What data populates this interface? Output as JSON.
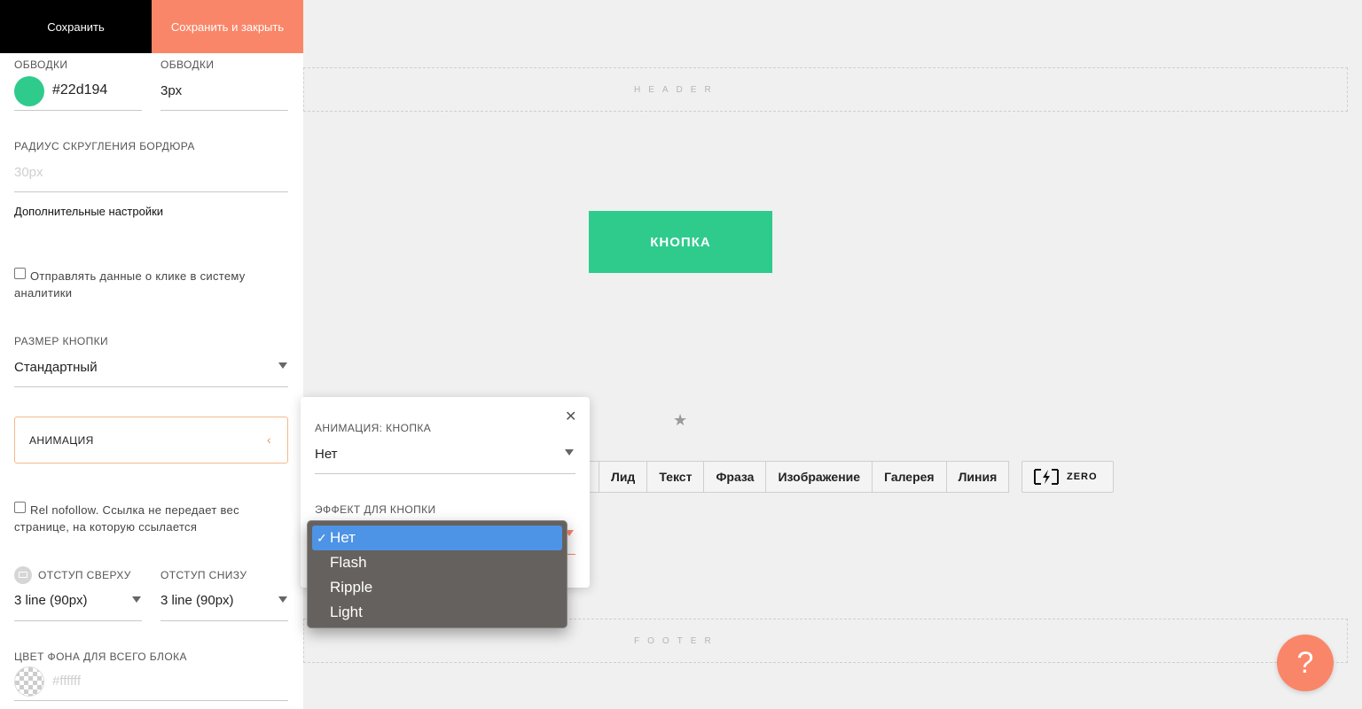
{
  "toolbar": {
    "save_label": "Сохранить",
    "save_close_label": "Сохранить и закрыть"
  },
  "settings": {
    "stroke_color": {
      "label": "ОБВОДКИ",
      "value": "#22d194"
    },
    "stroke_width": {
      "label": "ОБВОДКИ",
      "value": "3px"
    },
    "border_radius": {
      "label": "РАДИУС СКРУГЛЕНИЯ БОРДЮРА",
      "placeholder": "30px"
    },
    "advanced_title": "Дополнительные настройки",
    "analytics_checkbox": {
      "label": "Отправлять данные о клике в систему аналитики",
      "checked": false
    },
    "button_size": {
      "label": "РАЗМЕР КНОПКИ",
      "value": "Стандартный"
    },
    "animation_label": "АНИМАЦИЯ",
    "nofollow_checkbox": {
      "label": "Rel nofollow. Ссылка не передает вес странице, на которую ссылается",
      "checked": false
    },
    "padding_top": {
      "label": "ОТСТУП СВЕРХУ",
      "value": "3 line (90px)"
    },
    "padding_bottom": {
      "label": "ОТСТУП СНИЗУ",
      "value": "3 line (90px)"
    },
    "bg_color": {
      "label": "ЦВЕТ ФОНА ДЛЯ ВСЕГО БЛОКА",
      "placeholder": "#ffffff"
    }
  },
  "canvas": {
    "header_label": "HEADER",
    "footer_label": "FOOTER",
    "button_text": "КНОПКА",
    "categories": [
      "Лид",
      "Текст",
      "Фраза",
      "Изображение",
      "Галерея",
      "Линия"
    ],
    "zero_label": "ZERO"
  },
  "popup": {
    "animation_label": "АНИМАЦИЯ: КНОПКА",
    "animation_value": "Нет",
    "effect_label": "ЭФФЕКТ ДЛЯ КНОПКИ"
  },
  "dropdown": {
    "options": [
      "Нет",
      "Flash",
      "Ripple",
      "Light"
    ],
    "selected": "Нет"
  },
  "help_label": "?",
  "colors": {
    "accent": "#fa8669",
    "button": "#2ecb8c",
    "swatch": "#22d194",
    "selection": "#4d93e6"
  }
}
